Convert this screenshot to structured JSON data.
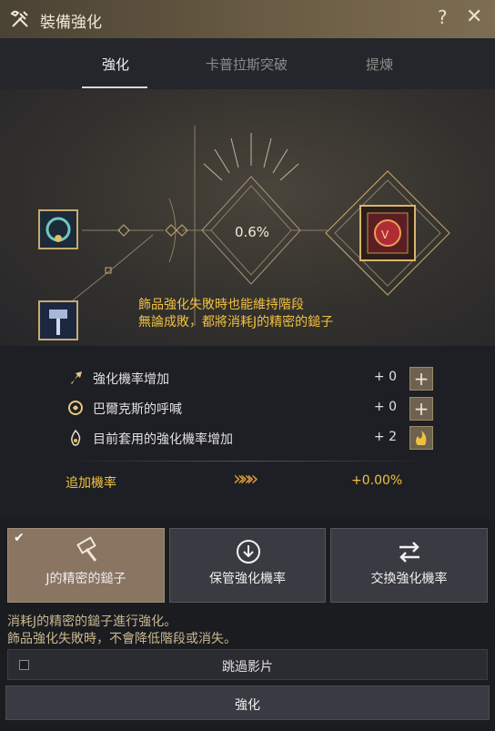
{
  "window": {
    "title": "裝備強化",
    "help_glyph": "?",
    "close_glyph": "✕"
  },
  "tabs": [
    {
      "label": "強化",
      "active": true
    },
    {
      "label": "卡普拉斯突破",
      "active": false
    },
    {
      "label": "提煉",
      "active": false
    }
  ],
  "stage": {
    "success_rate": "0.6%",
    "notice_line1": "飾品強化失敗時也能維持階段",
    "notice_line2": "無論成敗，都將消耗J的精密的鎚子",
    "icons": [
      "necklace-item-icon",
      "hammer-material-icon",
      "target-accessory-icon"
    ]
  },
  "bonuses": [
    {
      "label": "強化機率增加",
      "value": "+ 0",
      "icon": "arrow-up-icon",
      "button": "+"
    },
    {
      "label": "巴爾克斯的呼喊",
      "value": "+ 0",
      "icon": "valks-cry-icon",
      "button": "+"
    },
    {
      "label": "目前套用的強化機率增加",
      "value": "+ 2",
      "icon": "flame-icon",
      "button": "stack-icon"
    }
  ],
  "total": {
    "label": "追加機率",
    "value": "+0.00%",
    "arrows": "»»»"
  },
  "options": [
    {
      "label": "J的精密的鎚子",
      "icon": "hammer-icon",
      "selected": true
    },
    {
      "label": "保管強化機率",
      "icon": "download-circle-icon",
      "selected": false
    },
    {
      "label": "交換強化機率",
      "icon": "swap-arrows-icon",
      "selected": false
    }
  ],
  "description": {
    "line1": "消耗J的精密的鎚子進行強化。",
    "line2": "飾品強化失敗時，不會降低階段或消失。"
  },
  "skip_cutscene": {
    "label": "跳過影片",
    "checked": false
  },
  "enhance_button": {
    "label": "強化"
  },
  "colors": {
    "accent_gold": "#f0c040",
    "selected_option": "#8a7462",
    "title_bar": "#6a5c44"
  }
}
